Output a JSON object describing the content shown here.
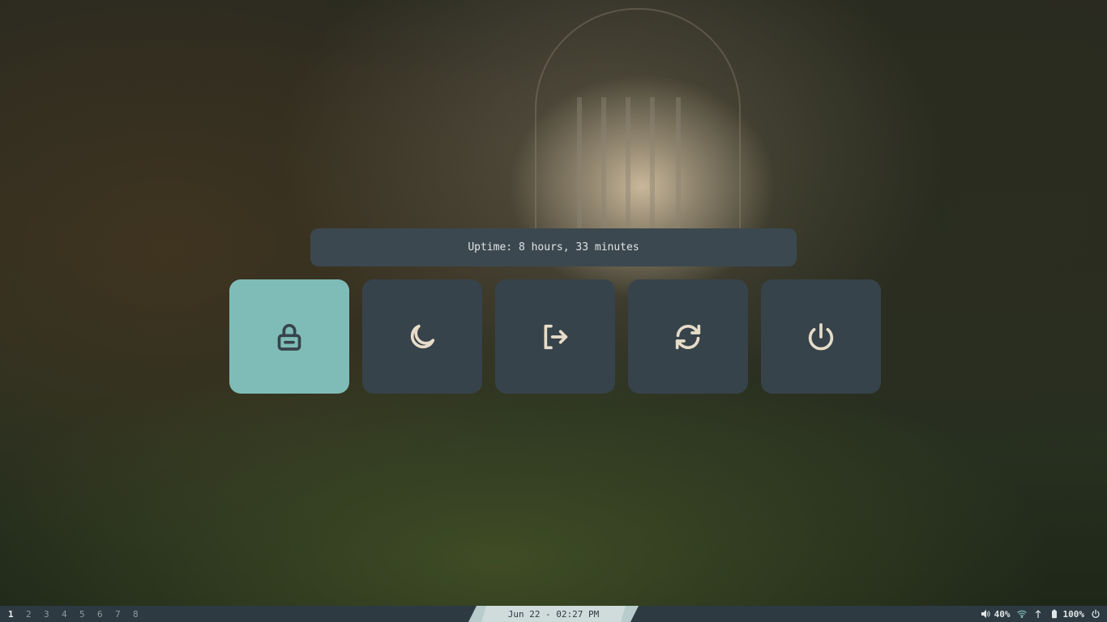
{
  "uptime": "Uptime: 8 hours, 33 minutes",
  "actions": [
    {
      "name": "lock",
      "icon": "lock-icon",
      "selected": true
    },
    {
      "name": "suspend",
      "icon": "moon-icon",
      "selected": false
    },
    {
      "name": "logout",
      "icon": "logout-icon",
      "selected": false
    },
    {
      "name": "reboot",
      "icon": "refresh-icon",
      "selected": false
    },
    {
      "name": "shutdown",
      "icon": "power-icon",
      "selected": false
    }
  ],
  "taskbar": {
    "workspaces": [
      "1",
      "2",
      "3",
      "4",
      "5",
      "6",
      "7",
      "8"
    ],
    "active_workspace": "1",
    "clock": "Jun 22 - 02:27 PM",
    "volume": "40%",
    "battery": "100%"
  },
  "colors": {
    "accent": "#7fbcb8",
    "button": "#37434b",
    "panel": "#3b4850",
    "icon": "#e6dcc8"
  }
}
